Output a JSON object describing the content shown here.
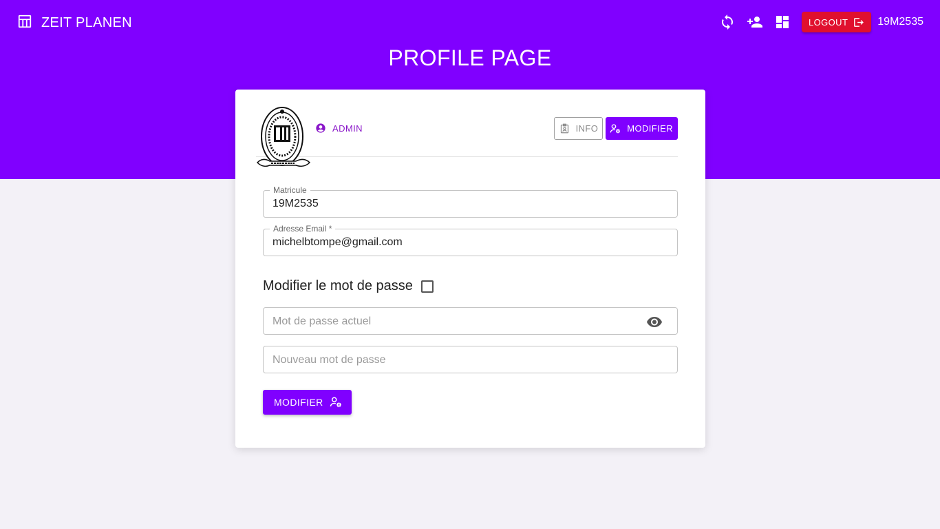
{
  "header": {
    "brand_icon": "table-icon",
    "title": "ZEIT PLANEN",
    "icons": [
      "sync-icon",
      "person-add-icon",
      "dashboard-icon"
    ],
    "logout_label": "LOGOUT",
    "logout_icon": "logout-icon",
    "user_id": "19M2535"
  },
  "page": {
    "title": "PROFILE PAGE",
    "accent_color": "#8000ff",
    "logout_color": "#e0102e"
  },
  "profile": {
    "emblem": "university-emblem",
    "role_icon": "account-circle-icon",
    "role": "ADMIN",
    "tabs": {
      "info_label": "INFO",
      "info_icon": "badge-icon",
      "modify_label": "MODIFIER",
      "modify_icon": "manage-accounts-icon"
    }
  },
  "form": {
    "matricule": {
      "label": "Matricule",
      "value": "19M2535"
    },
    "email": {
      "label": "Adresse Email *",
      "value": "michelbtompe@gmail.com"
    },
    "change_password": {
      "label": "Modifier le mot de passe",
      "checked": false
    },
    "current_password": {
      "placeholder": "Mot de passe actuel",
      "icon": "eye-icon"
    },
    "new_password": {
      "placeholder": "Nouveau mot de passe"
    },
    "submit_label": "MODIFIER",
    "submit_icon": "manage-accounts-icon"
  }
}
